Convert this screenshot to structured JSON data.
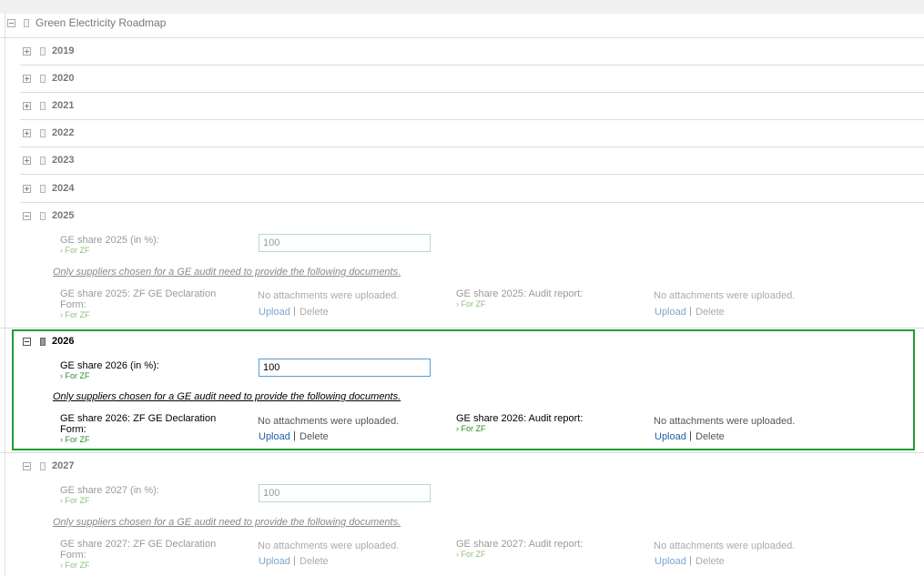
{
  "tree": {
    "root_label": "Green Electricity Roadmap",
    "collapsed_years": [
      "2019",
      "2020",
      "2021",
      "2022",
      "2023",
      "2024"
    ],
    "sections": [
      {
        "year": "2025",
        "share_label": "GE share 2025 (in %):",
        "share_sub": "› For ZF",
        "share_value": "100",
        "note": "Only suppliers chosen for a GE audit need to provide the following documents.",
        "decl_label_line1": "GE share 2025: ZF GE Declaration",
        "decl_label_line2": "Form:",
        "decl_sub": "› For ZF",
        "decl_no_att": "No attachments were uploaded.",
        "audit_label": "GE share 2025: Audit report:",
        "audit_sub": "› For ZF",
        "audit_no_att": "No attachments were uploaded.",
        "upload": "Upload",
        "sep": "|",
        "delete": "Delete"
      },
      {
        "year": "2026",
        "share_label": "GE share 2026 (in %):",
        "share_sub": "› For ZF",
        "share_value": "100",
        "note": "Only suppliers chosen for a GE audit need to provide the following documents.",
        "decl_label_line1": "GE share 2026: ZF GE Declaration",
        "decl_label_line2": "Form:",
        "decl_sub": "› For ZF",
        "decl_no_att": "No attachments were uploaded.",
        "audit_label": "GE share 2026: Audit report:",
        "audit_sub": "› For ZF",
        "audit_no_att": "No attachments were uploaded.",
        "upload": "Upload",
        "sep": "|",
        "delete": "Delete"
      },
      {
        "year": "2027",
        "share_label": "GE share 2027 (in %):",
        "share_sub": "› For ZF",
        "share_value": "100",
        "note": "Only suppliers chosen for a GE audit need to provide the following documents.",
        "decl_label_line1": "GE share 2027: ZF GE Declaration",
        "decl_label_line2": "Form:",
        "decl_sub": "› For ZF",
        "decl_no_att": "No attachments were uploaded.",
        "audit_label": "GE share 2027: Audit report:",
        "audit_sub": "› For ZF",
        "audit_no_att": "No attachments were uploaded.",
        "upload": "Upload",
        "sep": "|",
        "delete": "Delete"
      }
    ]
  }
}
